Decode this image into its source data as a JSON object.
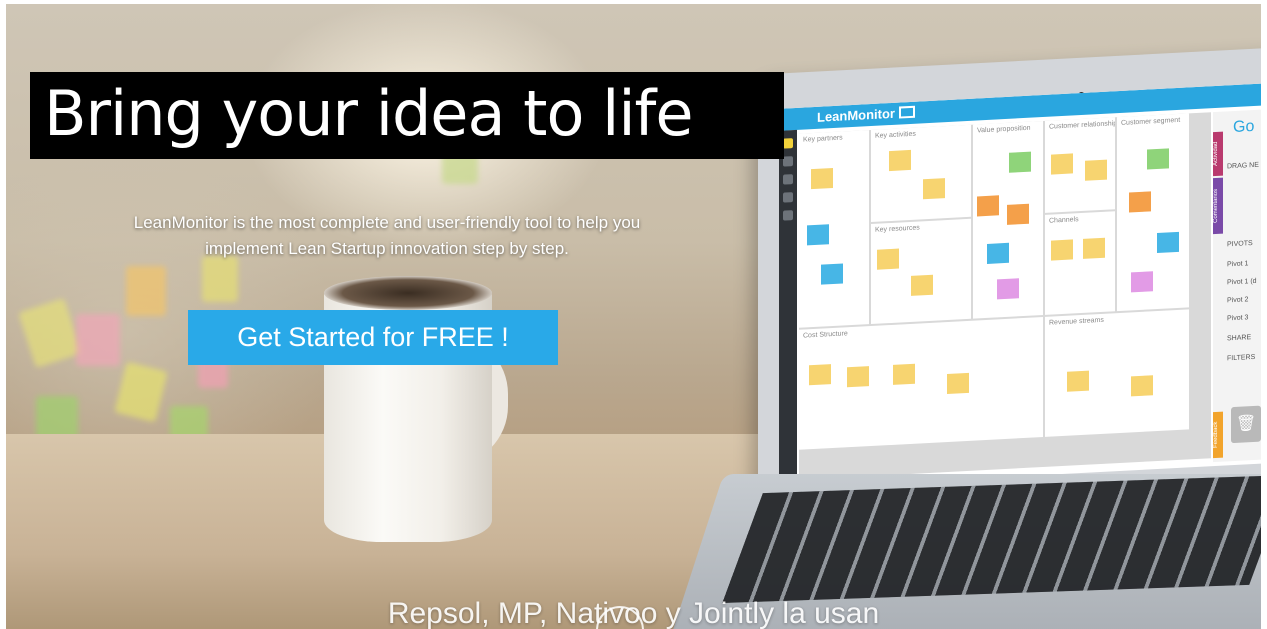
{
  "hero": {
    "headline": "Bring your idea to life",
    "subtitle_line1": "LeanMonitor is the most complete and user-friendly tool to help you",
    "subtitle_line2": "implement Lean Startup innovation step by step.",
    "cta_label": "Get Started for FREE !",
    "users_line": "Repsol, MP, Nativoo y Jointly la usan",
    "scroll_icon_glyph": "⌄"
  },
  "app_preview": {
    "brand": "LeanMonitor",
    "go_label": "Go",
    "canvas_blocks": [
      "Key partners",
      "Key activities",
      "Value proposition",
      "Customer relationships",
      "Customer segment",
      "Key resources",
      "Channels",
      "Cost Structure",
      "Revenue streams"
    ],
    "side_tabs": [
      "Actividad",
      "Comentarios",
      "Feedback"
    ],
    "side_rows": [
      "DRAG NE",
      "PIVOTS",
      "Pivot 1",
      "Pivot 1 (d",
      "Pivot 2",
      "Pivot 3",
      "SHARE",
      "FILTERS"
    ],
    "note_colors": {
      "yellow": "#f7d470",
      "green": "#8fd47a",
      "blue": "#47b6e6",
      "orange": "#f4a04a",
      "pink": "#e29be6"
    }
  },
  "colors": {
    "accent": "#29a9e8",
    "headline_bg": "#000000",
    "app_topbar": "#2aa6df"
  }
}
